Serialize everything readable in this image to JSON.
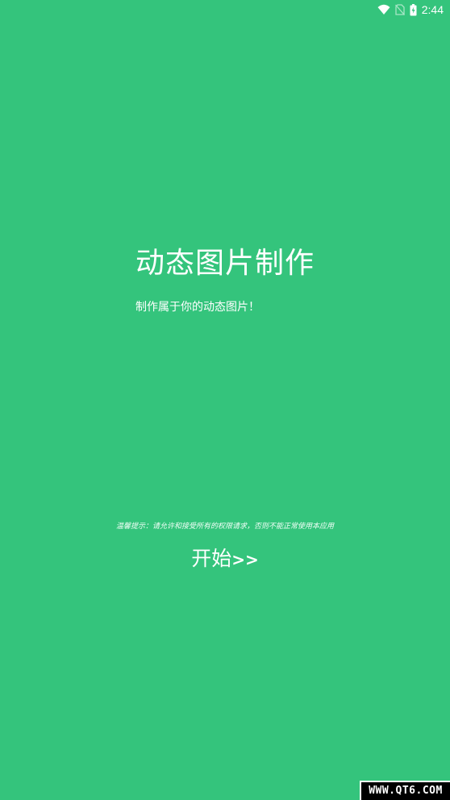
{
  "status_bar": {
    "time": "2:44",
    "icons": [
      "wifi-icon",
      "no-sim-icon",
      "battery-charging-icon"
    ]
  },
  "main": {
    "title": "动态图片制作",
    "subtitle": "制作属于你的动态图片！",
    "notice": "温馨提示：请允许和接受所有的权限请求，否则不能正常使用本应用",
    "start_label": "开始",
    "start_arrows": ">>"
  },
  "watermark": {
    "text": "WWW.QT6.COM"
  },
  "colors": {
    "background": "#34c47c",
    "text": "#ffffff"
  }
}
